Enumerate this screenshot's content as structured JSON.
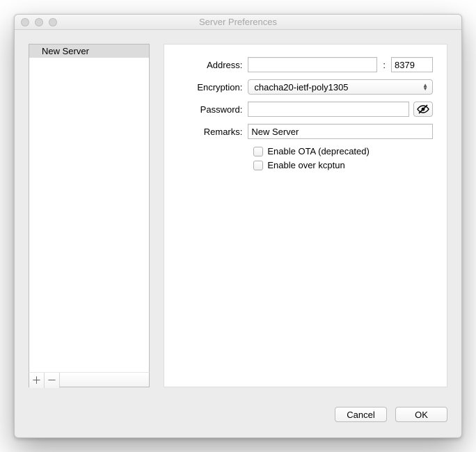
{
  "window": {
    "title": "Server Preferences"
  },
  "sidebar": {
    "items": [
      {
        "label": "New Server",
        "selected": true
      }
    ]
  },
  "form": {
    "address_label": "Address:",
    "address_value": "",
    "port_value": "8379",
    "encryption_label": "Encryption:",
    "encryption_value": "chacha20-ietf-poly1305",
    "password_label": "Password:",
    "password_value": "",
    "remarks_label": "Remarks:",
    "remarks_value": "New Server",
    "enable_ota_label": "Enable OTA (deprecated)",
    "enable_kcptun_label": "Enable over kcptun"
  },
  "buttons": {
    "cancel": "Cancel",
    "ok": "OK"
  },
  "glyphs": {
    "plus": "＋",
    "minus": "－",
    "colon": ":"
  }
}
